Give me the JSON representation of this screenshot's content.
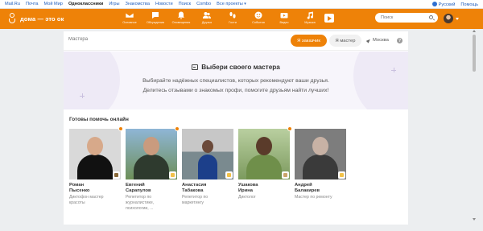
{
  "topbar": {
    "links": [
      "Mail.Ru",
      "Почта",
      "Мой Мир",
      "Одноклассники",
      "Игры",
      "Знакомства",
      "Новости",
      "Поиск",
      "Combo",
      "Все проекты"
    ],
    "language": "Русский",
    "help": "Помощь"
  },
  "header": {
    "logo_text": "дома — это ок",
    "nav": [
      {
        "label": "Основное",
        "icon": "mail-icon"
      },
      {
        "label": "Обсуждения",
        "icon": "chat-icon"
      },
      {
        "label": "Оповещения",
        "icon": "bell-icon"
      },
      {
        "label": "Друзья",
        "icon": "friends-icon"
      },
      {
        "label": "Гости",
        "icon": "footprints-icon"
      },
      {
        "label": "События",
        "icon": "events-icon"
      },
      {
        "label": "Видео",
        "icon": "video-icon"
      },
      {
        "label": "Музыка",
        "icon": "music-icon"
      }
    ],
    "search_placeholder": "Поиск",
    "brand_color": "#ee8208"
  },
  "filters": {
    "field_placeholder": "Мастера",
    "customer_label": "Я заказчик",
    "master_label": "Я мастер",
    "city": "Москва",
    "help": "?"
  },
  "promo": {
    "title": "Выбери своего мастера",
    "line1": "Выбирайте надёжных специалистов, которых рекомендуют ваши друзья.",
    "line2": "Делитесь отзывами о знакомых профи, помогите друзьям найти лучших!"
  },
  "section": {
    "title": "Готовы помочь онлайн"
  },
  "masters": [
    {
      "first": "Роман",
      "last": "Пысенко",
      "desc1": "Диктофон мастер",
      "desc2": "красоты",
      "online": true
    },
    {
      "first": "Евгений",
      "last": "Сарапулов",
      "desc1": "Репетитор по",
      "desc2": "журналистике,",
      "desc3": "психологии, ...",
      "online": true
    },
    {
      "first": "Анастасия",
      "last": "Табакова",
      "desc1": "Репетитор по",
      "desc2": "маркетингу",
      "online": false
    },
    {
      "first": "Ушакова",
      "last": "Ирина",
      "desc1": "Диктолог",
      "online": true
    },
    {
      "first": "Андрей",
      "last": "Балакирев",
      "desc1": "Мастер по ремонту",
      "online": false
    }
  ]
}
